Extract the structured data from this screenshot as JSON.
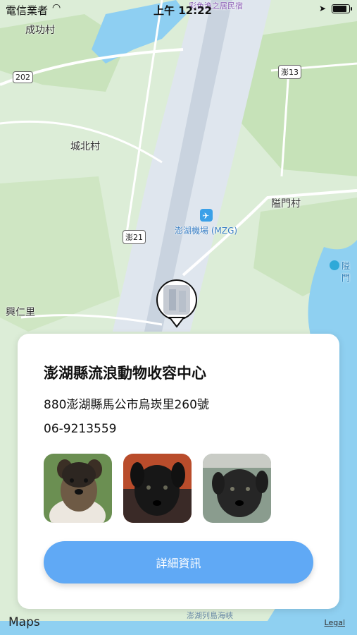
{
  "status_bar": {
    "carrier": "電信業者",
    "time": "上午 12:22"
  },
  "map": {
    "labels": {
      "chenggong": "成功村",
      "chengbei": "城北村",
      "ximen": "隘門村",
      "xingren": "興仁里",
      "airport": "澎湖機場 (MZG)",
      "bnb": "彩色漁之居民宿",
      "ximen_right": "隘門",
      "strait": "澎湖列島海峽"
    },
    "roads": {
      "r202": "202",
      "r13": "澎13",
      "r21": "澎21"
    },
    "branding": "Maps",
    "legal": "Legal"
  },
  "card": {
    "title": "澎湖縣流浪動物收容中心",
    "address": "880澎湖縣馬公市烏崁里260號",
    "phone": "06-9213559",
    "button_label": "詳細資訊",
    "button_color": "#60a9f5"
  }
}
